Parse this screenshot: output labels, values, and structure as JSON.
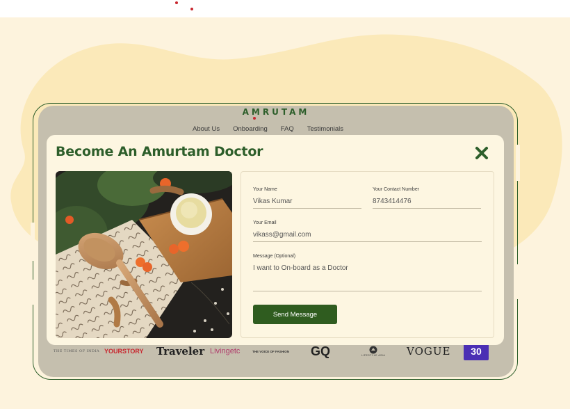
{
  "brand": {
    "logo": "AMRUTAM"
  },
  "nav": {
    "items": [
      "About Us",
      "Onboarding",
      "FAQ",
      "Testimonials"
    ]
  },
  "modal": {
    "title": "Become An Amurtam Doctor",
    "close_icon": "close-x-icon",
    "photo_alt": "herbs-turmeric-spoon-photo"
  },
  "form": {
    "name": {
      "label": "Your Name",
      "value": "Vikas Kumar"
    },
    "contact": {
      "label": "Your Contact Number",
      "value": "8743414476"
    },
    "email": {
      "label": "Your Email",
      "value": "vikass@gmail.com"
    },
    "message": {
      "label": "Message (Optional)",
      "value": "I want to On-board as a Doctor"
    },
    "submit_label": "Send Message"
  },
  "press_logos": [
    "THE TIMES OF INDIA",
    "YOURSTORY",
    "Traveler",
    "Livingetc",
    "THE VOICE OF FASHION",
    "GQ",
    "LIFESTYLE ASIA",
    "VOGUE",
    "30"
  ],
  "colors": {
    "accent_green": "#2d5e2a",
    "button_green": "#2f5c1f",
    "background_cream": "#fdf3dd",
    "modal_bg": "#fdf6e1",
    "brand_red": "#c8272f"
  }
}
